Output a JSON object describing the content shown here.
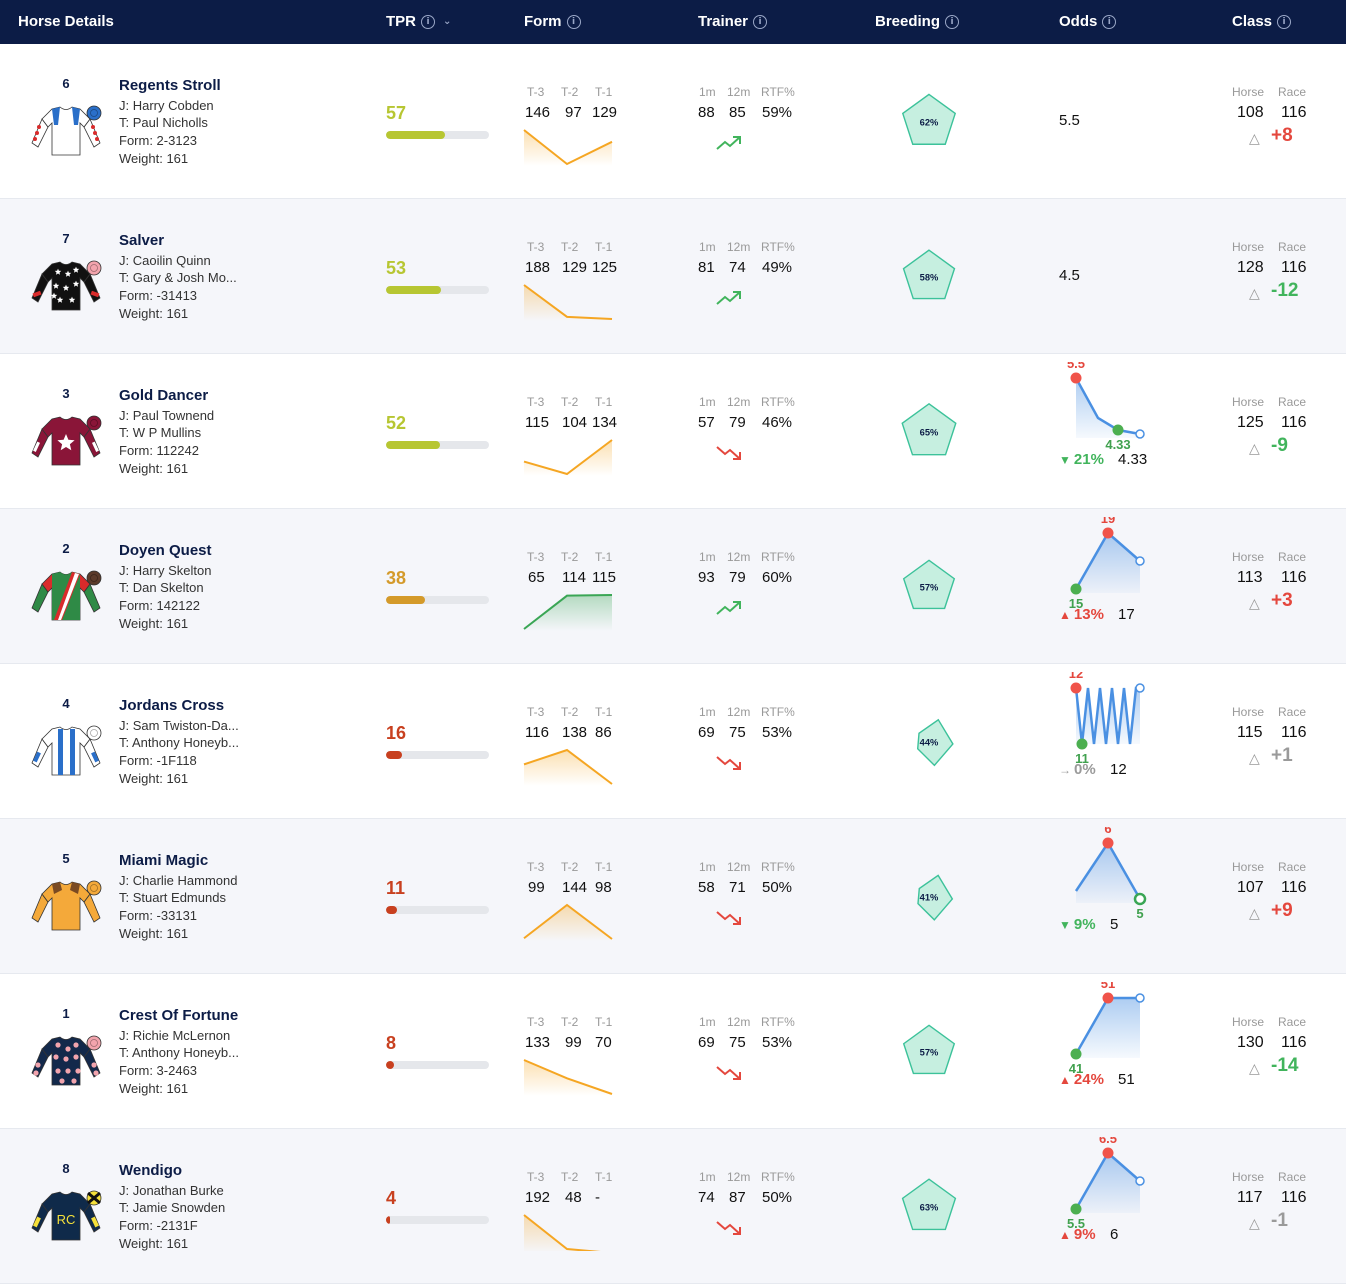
{
  "header": {
    "horse_details": "Horse Details",
    "tpr": "TPR",
    "form": "Form",
    "trainer": "Trainer",
    "breeding": "Breeding",
    "odds": "Odds",
    "class": "Class",
    "info_icon": "i",
    "sort_icon": "chevron-down"
  },
  "labels": {
    "t3": "T-3",
    "t2": "T-2",
    "t1": "T-1",
    "m1": "1m",
    "m12": "12m",
    "rtf": "RTF%",
    "horse": "Horse",
    "race": "Race",
    "delta_icon": "△"
  },
  "colors": {
    "header_bg": "#0c1c46",
    "tpr_high": "#b7c632",
    "tpr_mid": "#d49a2a",
    "tpr_low": "#c8401f",
    "form_up": "#f5a623",
    "form_green": "#3aa655",
    "breeding": "#3cc29a",
    "odds_line": "#4a90e2",
    "red": "#e4473d",
    "green": "#41b45c"
  },
  "horses": [
    {
      "number": "6",
      "name": "Regents Stroll",
      "jockey": "J: Harry Cobden",
      "trainer": "T: Paul Nicholls",
      "form": "Form: 2-3123",
      "weight": "Weight: 161",
      "silk": "white-blue-red-spots",
      "tpr": "57",
      "tpr_pct": 57,
      "tpr_color": "#b7c632",
      "form_vals": [
        "146",
        "97",
        "129"
      ],
      "form_color": "#f5a623",
      "trainer_1m": "88",
      "trainer_12m": "85",
      "trainer_rtf": "59%",
      "trainer_trend": "up",
      "breeding": "62%",
      "breeding_pct": 62,
      "odds": "5.5",
      "class_horse": "108",
      "class_race": "116",
      "class_delta": "+8",
      "class_delta_color": "red"
    },
    {
      "number": "7",
      "name": "Salver",
      "jockey": "J: Caoilin Quinn",
      "trainer": "T: Gary & Josh Mo...",
      "form": "Form: -31413",
      "weight": "Weight: 161",
      "silk": "black-white-stars",
      "tpr": "53",
      "tpr_pct": 53,
      "tpr_color": "#b7c632",
      "form_vals": [
        "188",
        "129",
        "125"
      ],
      "form_color": "#f5a623",
      "trainer_1m": "81",
      "trainer_12m": "74",
      "trainer_rtf": "49%",
      "trainer_trend": "up",
      "breeding": "58%",
      "breeding_pct": 58,
      "odds": "4.5",
      "class_horse": "128",
      "class_race": "116",
      "class_delta": "-12",
      "class_delta_color": "green"
    },
    {
      "number": "3",
      "name": "Gold Dancer",
      "jockey": "J: Paul Townend",
      "trainer": "T: W P Mullins",
      "form": "Form: 112242",
      "weight": "Weight: 161",
      "silk": "maroon-white-star",
      "tpr": "52",
      "tpr_pct": 52,
      "tpr_color": "#b7c632",
      "form_vals": [
        "115",
        "104",
        "134"
      ],
      "form_color": "#f5a623",
      "trainer_1m": "57",
      "trainer_12m": "79",
      "trainer_rtf": "46%",
      "trainer_trend": "down",
      "breeding": "65%",
      "breeding_pct": 65,
      "odds_chart": {
        "high": "5.5",
        "low": "4.33",
        "pct": "21%",
        "dir": "down",
        "current": "4.33"
      },
      "class_horse": "125",
      "class_race": "116",
      "class_delta": "-9",
      "class_delta_color": "green"
    },
    {
      "number": "2",
      "name": "Doyen Quest",
      "jockey": "J: Harry Skelton",
      "trainer": "T: Dan Skelton",
      "form": "Form: 142122",
      "weight": "Weight: 161",
      "silk": "green-red-white-sash",
      "tpr": "38",
      "tpr_pct": 38,
      "tpr_color": "#d49a2a",
      "form_vals": [
        "65",
        "114",
        "115"
      ],
      "form_color": "#3aa655",
      "trainer_1m": "93",
      "trainer_12m": "79",
      "trainer_rtf": "60%",
      "trainer_trend": "up",
      "breeding": "57%",
      "breeding_pct": 57,
      "odds_chart": {
        "high": "19",
        "low": "15",
        "pct": "13%",
        "dir": "up",
        "current": "17"
      },
      "class_horse": "113",
      "class_race": "116",
      "class_delta": "+3",
      "class_delta_color": "red"
    },
    {
      "number": "4",
      "name": "Jordans Cross",
      "jockey": "J: Sam Twiston-Da...",
      "trainer": "T: Anthony Honeyb...",
      "form": "Form: -1F118",
      "weight": "Weight: 161",
      "silk": "white-blue-stripes",
      "tpr": "16",
      "tpr_pct": 16,
      "tpr_color": "#c8401f",
      "form_vals": [
        "116",
        "138",
        "86"
      ],
      "form_color": "#f5a623",
      "trainer_1m": "69",
      "trainer_12m": "75",
      "trainer_rtf": "53%",
      "trainer_trend": "down",
      "breeding": "44%",
      "breeding_pct": 44,
      "odds_chart": {
        "high": "12",
        "low": "11",
        "pct": "0%",
        "dir": "flat",
        "current": "12"
      },
      "class_horse": "115",
      "class_race": "116",
      "class_delta": "+1",
      "class_delta_color": "grey"
    },
    {
      "number": "5",
      "name": "Miami Magic",
      "jockey": "J: Charlie Hammond",
      "trainer": "T: Stuart Edmunds",
      "form": "Form: -33131",
      "weight": "Weight: 161",
      "silk": "orange-brown",
      "tpr": "11",
      "tpr_pct": 11,
      "tpr_color": "#c8401f",
      "form_vals": [
        "99",
        "144",
        "98"
      ],
      "form_color": "#f5a623",
      "trainer_1m": "58",
      "trainer_12m": "71",
      "trainer_rtf": "50%",
      "trainer_trend": "down",
      "breeding": "41%",
      "breeding_pct": 41,
      "odds_chart": {
        "high": "6",
        "low": "5",
        "pct": "9%",
        "dir": "down",
        "current": "5"
      },
      "class_horse": "107",
      "class_race": "116",
      "class_delta": "+9",
      "class_delta_color": "red"
    },
    {
      "number": "1",
      "name": "Crest Of Fortune",
      "jockey": "J: Richie McLernon",
      "trainer": "T: Anthony Honeyb...",
      "form": "Form: 3-2463",
      "weight": "Weight: 161",
      "silk": "navy-pink-spots",
      "tpr": "8",
      "tpr_pct": 8,
      "tpr_color": "#c8401f",
      "form_vals": [
        "133",
        "99",
        "70"
      ],
      "form_color": "#f5a623",
      "trainer_1m": "69",
      "trainer_12m": "75",
      "trainer_rtf": "53%",
      "trainer_trend": "down",
      "breeding": "57%",
      "breeding_pct": 57,
      "odds_chart": {
        "high": "51",
        "low": "41",
        "pct": "24%",
        "dir": "up",
        "current": "51"
      },
      "class_horse": "130",
      "class_race": "116",
      "class_delta": "-14",
      "class_delta_color": "green"
    },
    {
      "number": "8",
      "name": "Wendigo",
      "jockey": "J: Jonathan Burke",
      "trainer": "T: Jamie Snowden",
      "form": "Form: -2131F",
      "weight": "Weight: 161",
      "silk": "navy-yellow-rc",
      "silk_text": "RC",
      "tpr": "4",
      "tpr_pct": 4,
      "tpr_color": "#c8401f",
      "form_vals": [
        "192",
        "48",
        "-"
      ],
      "form_color": "#f5a623",
      "trainer_1m": "74",
      "trainer_12m": "87",
      "trainer_rtf": "50%",
      "trainer_trend": "down",
      "breeding": "63%",
      "breeding_pct": 63,
      "odds_chart": {
        "high": "6.5",
        "low": "5.5",
        "pct": "9%",
        "dir": "up",
        "current": "6"
      },
      "class_horse": "117",
      "class_race": "116",
      "class_delta": "-1",
      "class_delta_color": "grey"
    }
  ]
}
